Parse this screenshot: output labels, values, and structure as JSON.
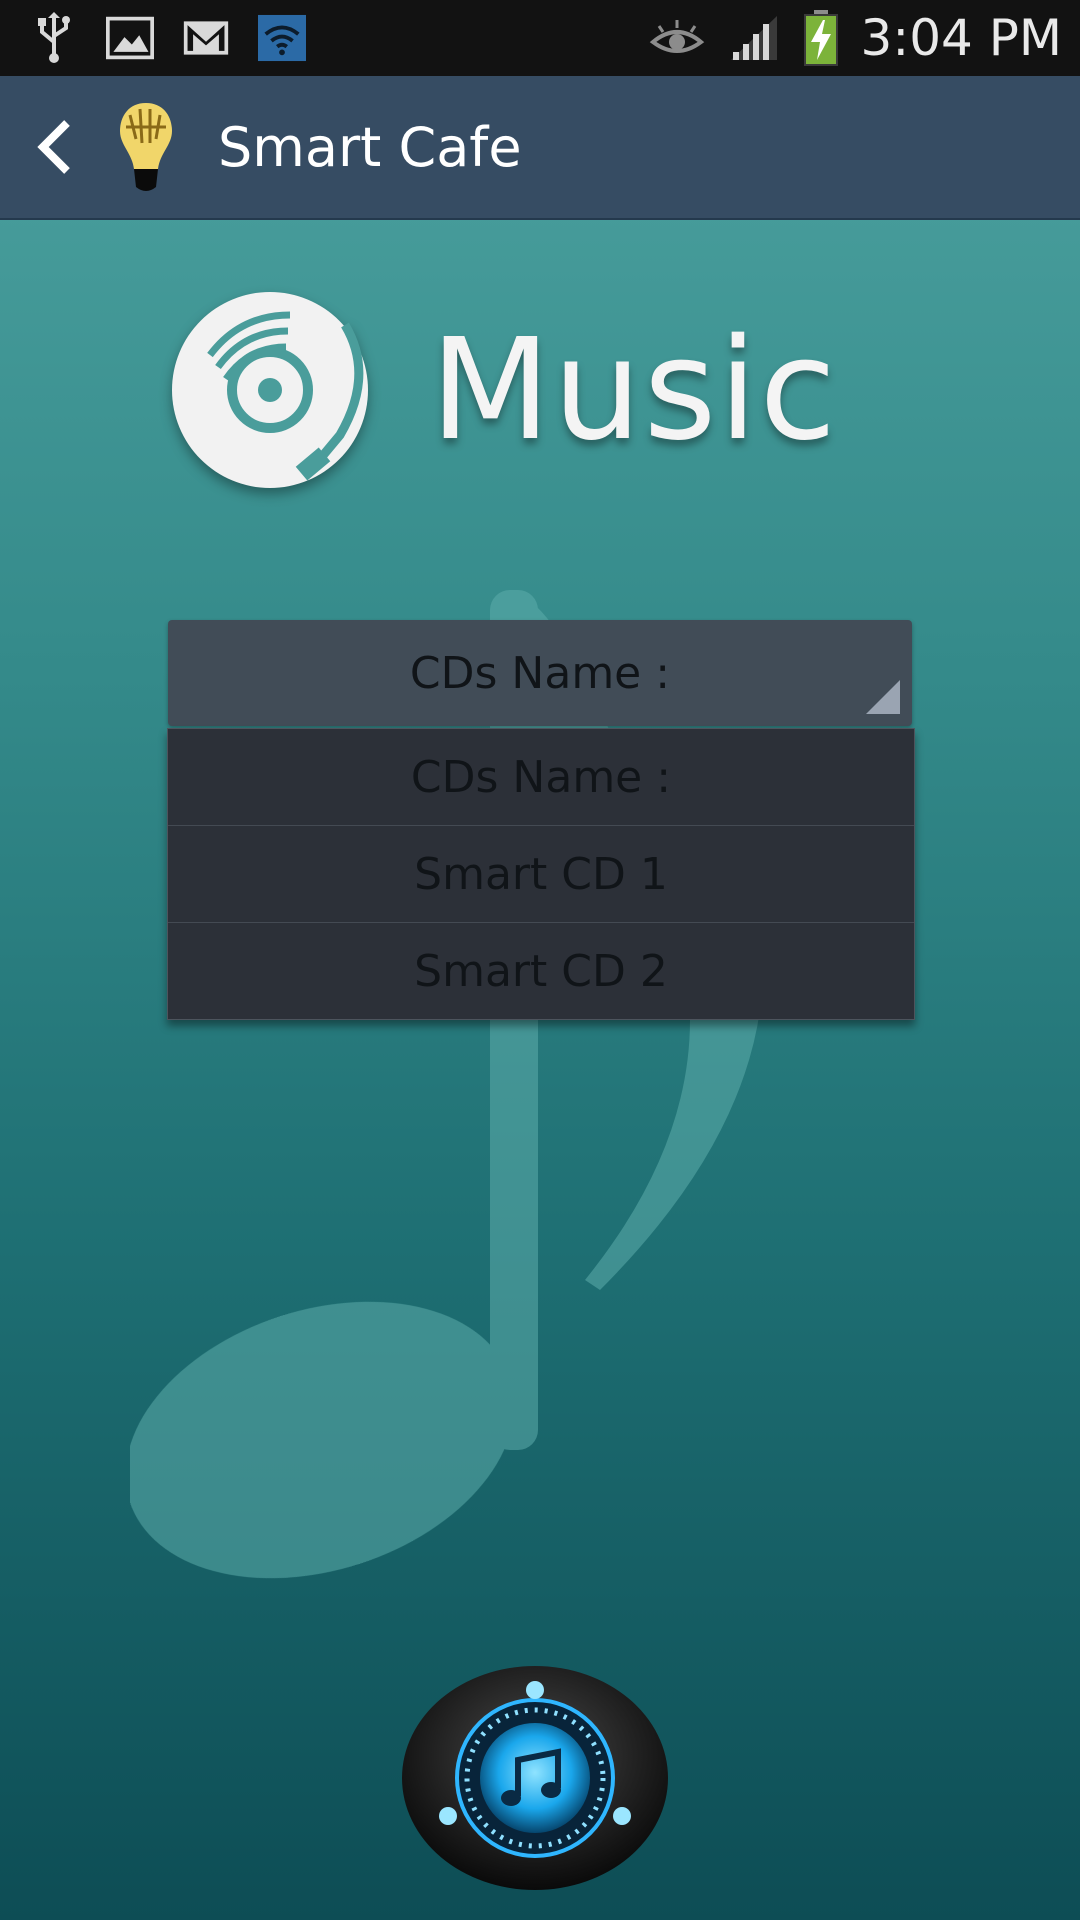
{
  "status_bar": {
    "time": "3:04 PM",
    "icons": [
      "usb-icon",
      "image-icon",
      "gmail-icon",
      "wifi-icon",
      "eye-icon",
      "signal-icon",
      "battery-charging-icon"
    ]
  },
  "action_bar": {
    "title": "Smart Cafe",
    "icons": [
      "back-arrow-icon",
      "lightbulb-logo-icon"
    ]
  },
  "header": {
    "title": "Music",
    "icon": "vinyl-disc-icon"
  },
  "spinner": {
    "selected": "CDs Name :",
    "options": [
      "CDs Name :",
      "Smart CD 1",
      "Smart CD 2"
    ]
  },
  "play_button": {
    "icon": "music-note-icon"
  },
  "colors": {
    "status_bar": "#121212",
    "action_bar": "#364c63",
    "bg_top": "#4ea3a1",
    "bg_bottom": "#0d4d55",
    "spinner": "#414c57",
    "dropdown": "#2c3038",
    "glow": "#2fb6ff"
  }
}
